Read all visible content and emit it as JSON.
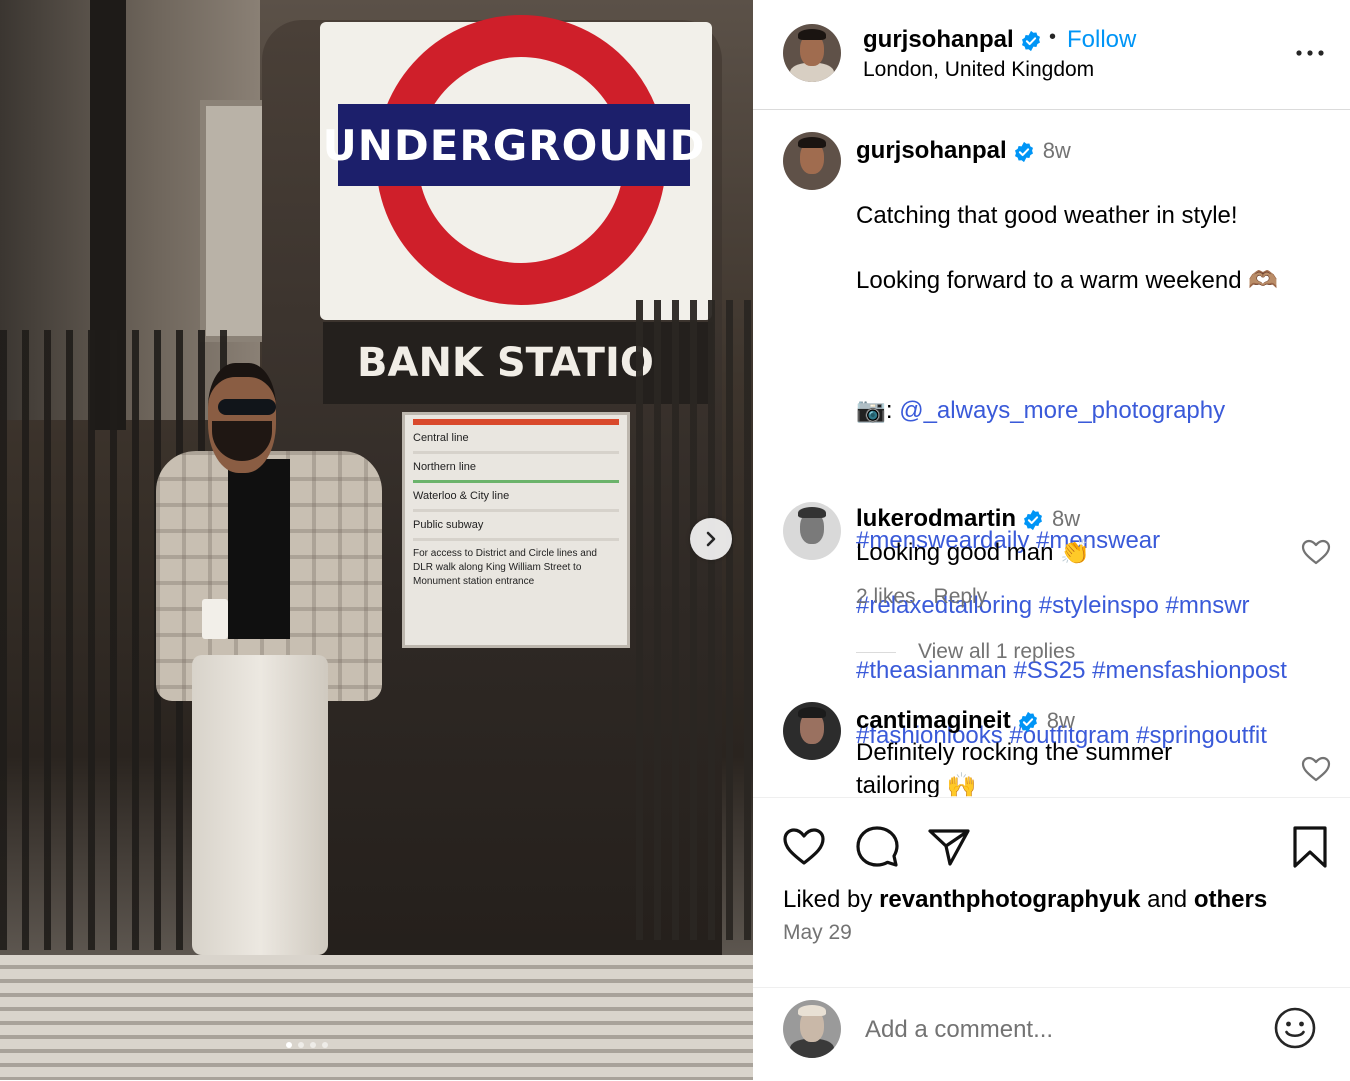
{
  "post": {
    "photo": {
      "sign_text": "UNDERGROUND",
      "station_text": "BANK STATIO",
      "board_lines": [
        "Central line",
        "Northern line",
        "Waterloo & City line",
        "Public subway"
      ],
      "board_note": "For access to District and Circle lines and DLR walk along King William Street to Monument station entrance",
      "carousel_total": 4,
      "carousel_index": 1
    },
    "header": {
      "username": "gurjsohanpal",
      "separator": "•",
      "follow_label": "Follow",
      "location": "London, United Kingdom"
    },
    "caption": {
      "username": "gurjsohanpal",
      "time": "8w",
      "text_line1": "Catching that good weather in style!",
      "text_line2": "Looking forward to a warm weekend 🫶🏽",
      "credit_prefix": "📷: ",
      "credit_link": "@_always_more_photography",
      "hashtags_1": "#mensweardaily #menswear",
      "hashtags_2": "#relaxedtailoring #styleinspo #mnswr",
      "hashtags_3": "#theasianman #SS25 #mensfashionpost",
      "hashtags_4": "#fashionlooks #outfitgram #springoutfit"
    },
    "comments": [
      {
        "username": "lukerodmartin",
        "time": "8w",
        "text": "Looking good man 👏",
        "likes": "2 likes",
        "reply": "Reply",
        "view_replies": "View all 1 replies"
      },
      {
        "username": "cantimagineit",
        "time": "8w",
        "text": "Definitely rocking the summer\ntailoring 🙌"
      }
    ],
    "liked_by": {
      "prefix": "Liked by",
      "user": "revanthphotographyuk",
      "and": "and",
      "others": "others"
    },
    "date": "May 29",
    "add_comment_placeholder": "Add a comment..."
  },
  "colors": {
    "link": "#3a5ad9",
    "follow": "#0095f6",
    "verified": "#0095f6",
    "muted": "#737373",
    "roundel_red": "#cf1f2a",
    "roundel_blue": "#1c1f6b"
  },
  "icons": [
    "verified-badge-icon",
    "more-options-icon",
    "heart-icon",
    "comment-icon",
    "share-icon",
    "bookmark-icon",
    "emoji-icon",
    "chevron-right-icon"
  ]
}
